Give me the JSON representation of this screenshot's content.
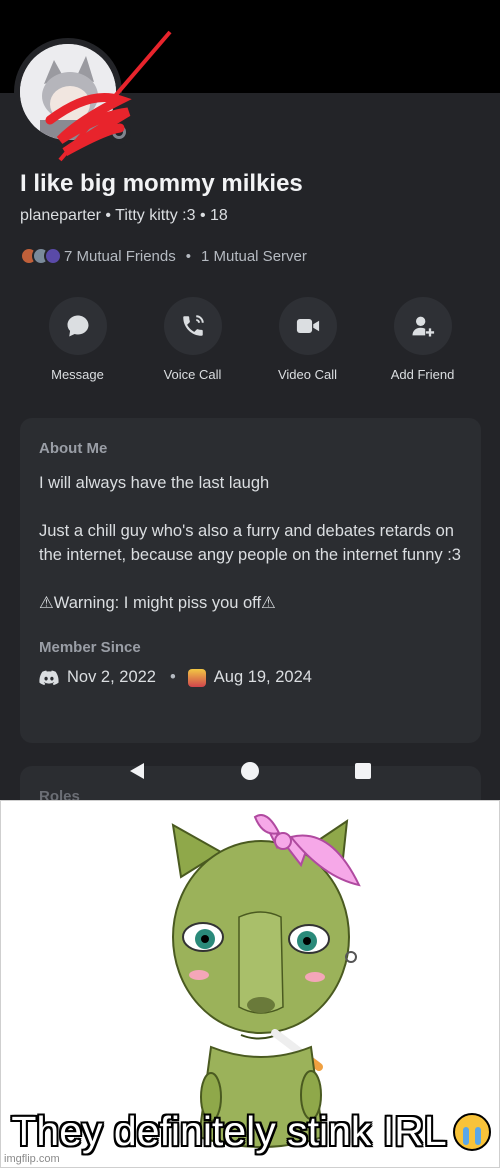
{
  "profile": {
    "display_name": "I like big mommy milkies",
    "username": "planeparter",
    "pronouns": "Titty kitty :3",
    "age": "18",
    "subline_sep": "•",
    "mutual_friends": "7 Mutual Friends",
    "mutual_sep": "•",
    "mutual_servers": "1 Mutual Server",
    "status": "offline"
  },
  "actions": [
    {
      "label": "Message",
      "icon": "message-icon"
    },
    {
      "label": "Voice Call",
      "icon": "phone-icon"
    },
    {
      "label": "Video Call",
      "icon": "video-icon"
    },
    {
      "label": "Add Friend",
      "icon": "add-friend-icon"
    }
  ],
  "about": {
    "heading": "About Me",
    "lines": [
      "I will always have the last laugh",
      "",
      "Just a chill guy who's also a furry and debates retards on the internet, because angy people on the internet funny :3",
      "",
      "⚠Warning: I might piss you off⚠"
    ]
  },
  "member_since": {
    "heading": "Member Since",
    "discord_date": "Nov 2, 2022",
    "sep": "•",
    "server_date": "Aug 19, 2024"
  },
  "roles": {
    "heading": "Roles"
  },
  "meme": {
    "caption": "They definitely stink IRL",
    "caption_emoji": "loudly-crying-face",
    "watermark": "imgflip.com"
  },
  "colors": {
    "background": "#232428",
    "card": "#2b2d31",
    "text": "#dbdee1",
    "muted": "#b5bac1",
    "scribble": "#e8242c"
  }
}
